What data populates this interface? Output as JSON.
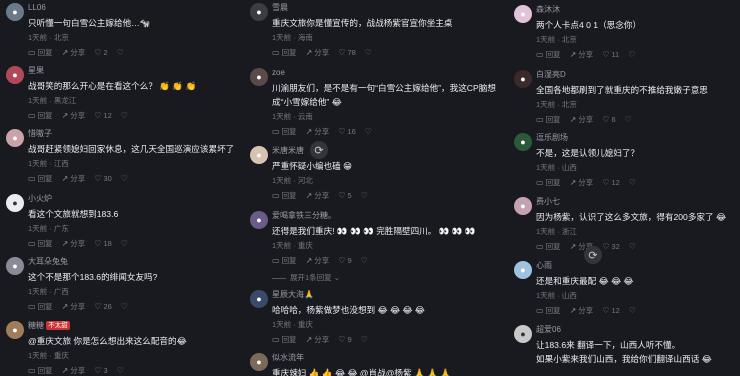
{
  "action_labels": {
    "reply": "回复",
    "share": "分享"
  },
  "columns": [
    {
      "comments": [
        {
          "user": "LL06",
          "avatar_color": "#6a7a8a",
          "text": "只听懂一句白雪公主嫁给他…🐄",
          "meta": "1天前 · 北京",
          "likes": "2"
        },
        {
          "user": "星果",
          "avatar_color": "#b04a5a",
          "text": "战哥笑的那么开心是在看这个么？ 👏 👏 👏",
          "meta": "1天前 · 黑龙江",
          "likes": "12"
        },
        {
          "user": "惜嗷子",
          "avatar_color": "#c9a3a8",
          "text": "战哥赶紧领媳妇回家休息，这几天全国巡演应该累坏了😜",
          "meta": "1天前 · 江西",
          "likes": "30"
        },
        {
          "user": "小火炉",
          "avatar_color": "#e9edf3",
          "text": "看这个文旅就想到183.6",
          "meta": "1天前 · 广东",
          "likes": "18"
        },
        {
          "user": "大耳朵兔兔",
          "avatar_color": "#8b8b98",
          "text": "这个不是那个183.6的绯闻女友吗?",
          "meta": "1天前 · 广西",
          "likes": "26"
        },
        {
          "user": "糖糖",
          "user_badge": "不太甜",
          "avatar_color": "#a07d5a",
          "text": "@重庆文旅 你是怎么想出来这么配音的😂",
          "meta": "1天前 · 重庆",
          "likes": "3"
        }
      ]
    },
    {
      "comments": [
        {
          "user": "雪晨",
          "avatar_color": "#3a3d44",
          "text": "重庆文旅你是懂宣传的，战战杨紫官宣你坐主桌",
          "meta": "1天前 · 海南",
          "likes": "78"
        },
        {
          "user": "zoe",
          "avatar_color": "#5a4a4a",
          "text": "川渝朋友们，是不是有一句“白雪公主嫁给他”，我这CP脑想",
          "text2": "成“小雪嫁给他” 😂",
          "meta": "1天前 · 云南",
          "likes": "16"
        },
        {
          "user": "米唐米唐",
          "avatar_color": "#d8c2b0",
          "text": "严重怀疑小编也磕 😁",
          "meta": "1天前 · 河北",
          "likes": "5"
        },
        {
          "user": "爱喝拿铁三分糖。",
          "avatar_color": "#6a5b8a",
          "text": "还得是我们重庆! 👀 👀 👀 完胜隔壁四川。 👀 👀 👀",
          "meta": "1天前 · 重庆",
          "likes": "9",
          "expand": "展开1条回复"
        },
        {
          "user": "星辰大海",
          "user_badge": "🙏",
          "avatar_color": "#3a4a6a",
          "text": "哈哈哈，杨紫做梦也没想到 😂 😂 😂 😂",
          "meta": "1天前 · 重庆",
          "likes": "9"
        },
        {
          "user": "似水流年",
          "avatar_color": "#7a6a5a",
          "text": "重庆辣妇 👍 👍 😂 😂 @肖战@杨紫 🙏 🙏 🙏",
          "meta": "",
          "likes": ""
        }
      ]
    },
    {
      "comments": [
        {
          "user": "森沐沐",
          "avatar_color": "#e0c3d8",
          "text": "两个人卡点4 0 1（思念你）",
          "meta": "1天前 · 北京",
          "likes": "11"
        },
        {
          "user": "白湿亮D",
          "avatar_color": "#3b2a2a",
          "text": "全国各地都刷到了就重庆的不推给我嫩子意思",
          "meta": "1天前 · 北京",
          "likes": "6"
        },
        {
          "user": "逗乐剧场",
          "avatar_color": "#2a5a3a",
          "text": "不是，这是认领儿媳妇了？",
          "meta": "1天前 · 山西",
          "likes": "12"
        },
        {
          "user": "费小七",
          "avatar_color": "#c4a2b0",
          "text": "因为杨紫，认识了这么多文旅，得有200多家了 😂",
          "meta": "1天前 · 浙江",
          "likes": "32"
        },
        {
          "user": "心雨",
          "avatar_color": "#9ec3e0",
          "text": "还是和重庆最配 😂 😂 😂",
          "meta": "1天前 · 山西",
          "likes": "12"
        },
        {
          "user": "超爱06",
          "avatar_color": "#c8c8c8",
          "text": "让183.6来 翻译一下，山西人听不懂。",
          "text2": "如果小紫来我们山西，我给你们翻译山西话 😂",
          "meta": "",
          "likes": ""
        }
      ]
    }
  ]
}
